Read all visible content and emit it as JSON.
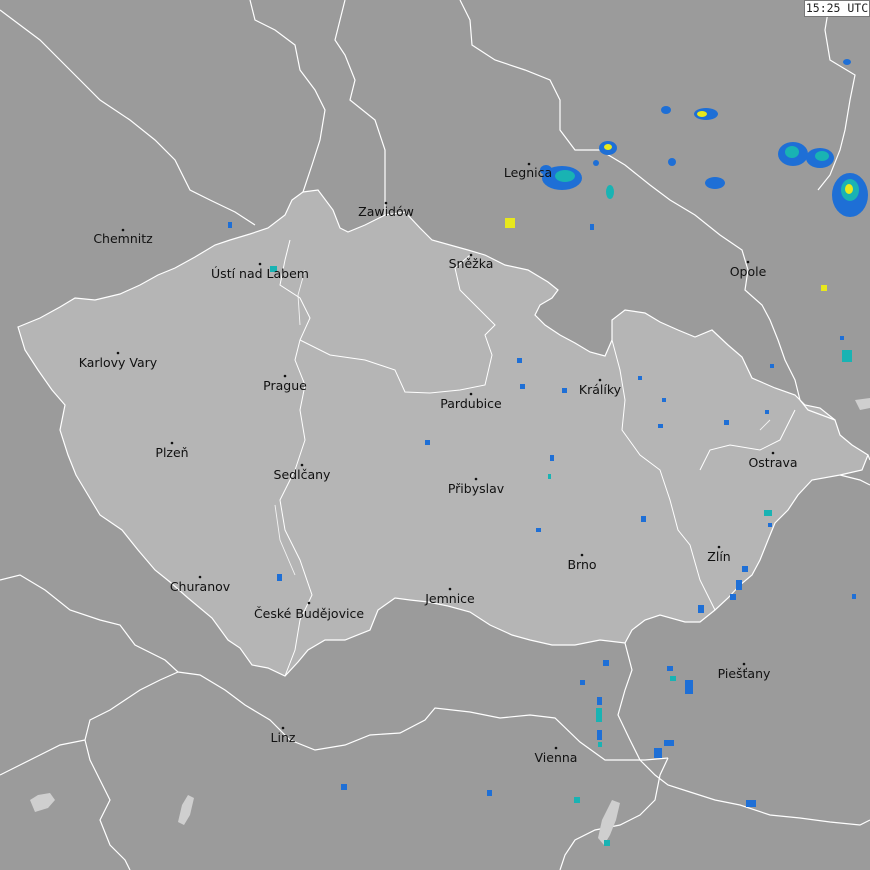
{
  "timestamp": "15:25 UTC",
  "cities": [
    {
      "id": "chemnitz",
      "name": "Chemnitz"
    },
    {
      "id": "zawidow",
      "name": "Zawidów"
    },
    {
      "id": "legnica",
      "name": "Legnica"
    },
    {
      "id": "usti",
      "name": "Ústí nad Labem"
    },
    {
      "id": "snezka",
      "name": "Sněžka"
    },
    {
      "id": "opole",
      "name": "Opole"
    },
    {
      "id": "karlovy-vary",
      "name": "Karlovy Vary"
    },
    {
      "id": "prague",
      "name": "Prague"
    },
    {
      "id": "pardubice",
      "name": "Pardubice"
    },
    {
      "id": "kraliky",
      "name": "Králíky"
    },
    {
      "id": "plzen",
      "name": "Plzeň"
    },
    {
      "id": "ostrava",
      "name": "Ostrava"
    },
    {
      "id": "sedlcany",
      "name": "Sedlčany"
    },
    {
      "id": "pribyslav",
      "name": "Přibyslav"
    },
    {
      "id": "zlin",
      "name": "Zlín"
    },
    {
      "id": "brno",
      "name": "Brno"
    },
    {
      "id": "churanov",
      "name": "Churanov"
    },
    {
      "id": "ceske-budejovice",
      "name": "České Budějovice"
    },
    {
      "id": "jemnice",
      "name": "Jemnice"
    },
    {
      "id": "piestany",
      "name": "Piešťany"
    },
    {
      "id": "linz",
      "name": "Linz"
    },
    {
      "id": "vienna",
      "name": "Vienna"
    }
  ],
  "colors": {
    "background": "#9b9b9b",
    "czechia": "#b5b5b5",
    "border": "#ffffff",
    "lake": "#cfcfcf",
    "radar_low": "#1e6fd6",
    "radar_mid": "#19b3b3",
    "radar_high": "#e8e81c"
  }
}
